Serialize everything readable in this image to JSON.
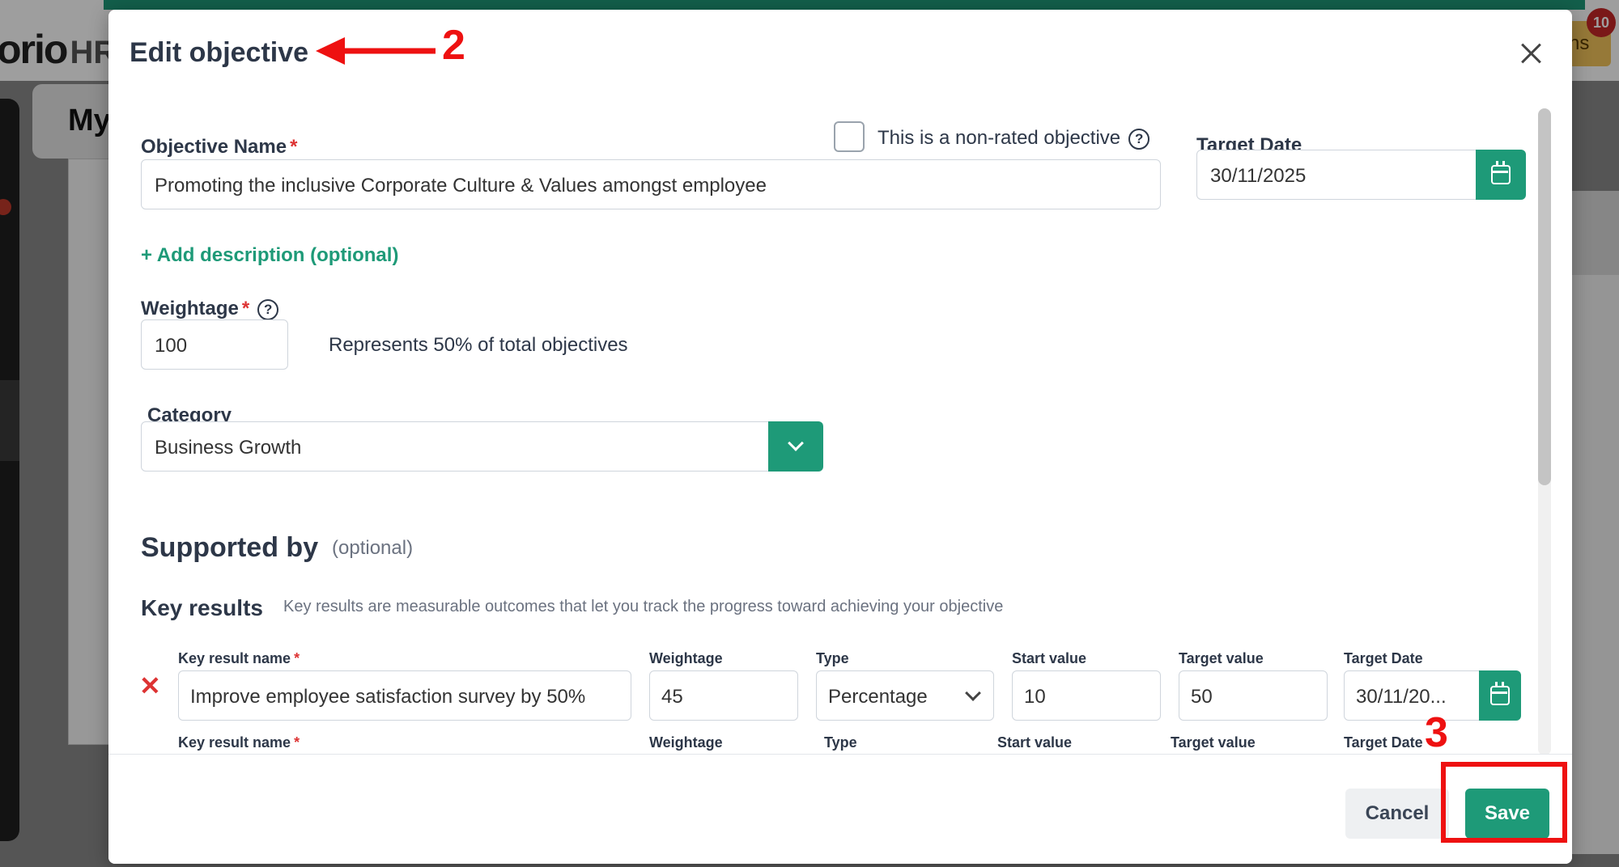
{
  "background": {
    "logo": "orio",
    "logo_suffix": "HR",
    "tab_partial": "My",
    "right_button_partial": "ns",
    "notification_count": "10"
  },
  "modal": {
    "title": "Edit objective",
    "objective_name_label": "Objective Name",
    "required_mark": "*",
    "objective_name_value": "Promoting the inclusive Corporate Culture & Values amongst employee",
    "non_rated_label": "This is a non-rated objective",
    "help_glyph": "?",
    "target_date_label": "Target Date",
    "target_date_value": "30/11/2025",
    "add_description": "+ Add description (optional)",
    "weightage_label": "Weightage",
    "weightage_value": "100",
    "weightage_note": "Represents 50% of total objectives",
    "category_label": "Category",
    "category_value": "Business Growth",
    "supported_by": "Supported by",
    "supported_by_optional": "(optional)",
    "key_results_heading": "Key results",
    "key_results_desc": "Key results are measurable outcomes that let you track the progress toward achieving your objective",
    "remove_glyph": "✕",
    "key_results": [
      {
        "name_label": "Key result name",
        "name": "Improve employee satisfaction survey by 50%",
        "weightage_label": "Weightage",
        "weightage": "45",
        "type_label": "Type",
        "type": "Percentage",
        "start_label": "Start value",
        "start": "10",
        "target_label": "Target value",
        "target": "50",
        "date_label": "Target Date",
        "date": "30/11/20..."
      },
      {
        "name_label": "Key result name",
        "weightage_label": "Weightage",
        "type_label": "Type",
        "start_label": "Start value",
        "target_label": "Target value",
        "date_label": "Target Date"
      }
    ]
  },
  "footer": {
    "cancel": "Cancel",
    "save": "Save"
  },
  "annotations": {
    "step_title": "2",
    "step_save": "3",
    "color": "#e11111"
  },
  "colors": {
    "accent": "#1e9a78",
    "required": "#dd3333"
  }
}
